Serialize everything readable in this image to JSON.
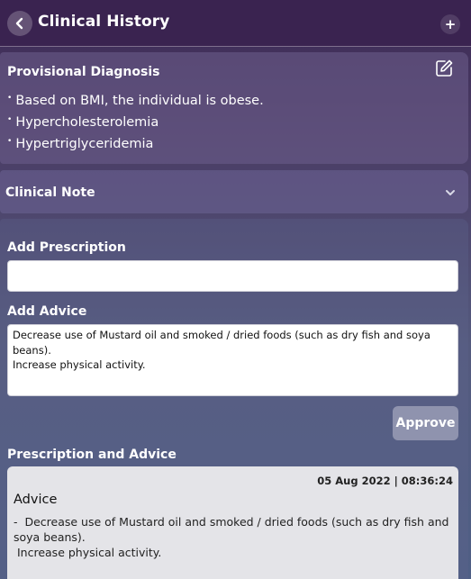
{
  "header": {
    "title": "Clinical History",
    "add_label": "+"
  },
  "diagnosis": {
    "title": "Provisional Diagnosis",
    "items": [
      "Based on BMI, the individual is obese.",
      "Hypercholesterolemia",
      "Hypertriglyceridemia"
    ]
  },
  "clinical_note": {
    "label": "Clinical Note"
  },
  "prescription": {
    "label": "Add Prescription",
    "value": ""
  },
  "advice_input": {
    "label": "Add Advice",
    "value": "Decrease use of Mustard oil and smoked / dried foods (such as dry fish and soya beans).\nIncrease physical activity."
  },
  "approve_label": "Approve",
  "history": {
    "section_title": "Prescription and Advice",
    "timestamp": "05 Aug 2022 | 08:36:24",
    "heading": "Advice",
    "body": "-  Decrease use of Mustard oil and smoked / dried foods (such as dry fish and soya beans).\n Increase physical activity."
  },
  "icons": {
    "back": "chevron-left-icon",
    "edit": "edit-icon",
    "expand": "chevron-down-icon"
  }
}
